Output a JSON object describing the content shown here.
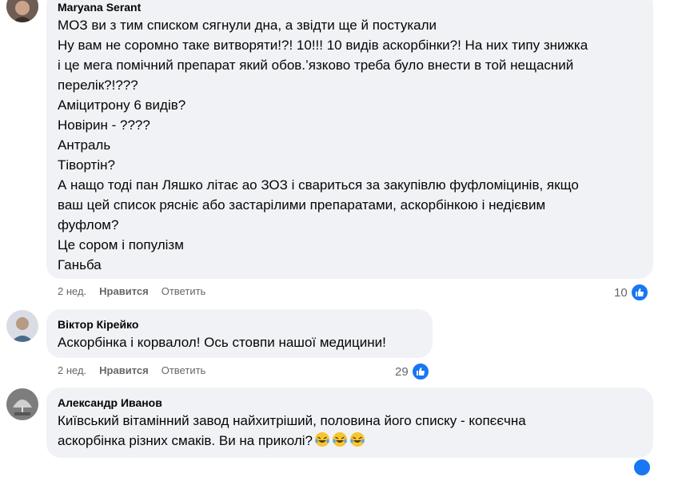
{
  "comments": [
    {
      "author": "Maryana Serant",
      "lines": [
        "МОЗ ви з тим списком сягнули дна, а звідти ще й постукали",
        "Ну вам не соромно таке витворяти!?! 10!!! 10 видів аскорбінки?! На них типу знижка",
        "і це мега помічний препарат який обов.’язково треба було внести в той нещасний",
        "перелік?!???",
        "Аміцитрону 6 видів?",
        "Новірин - ????",
        "Антраль",
        "Тівортін?",
        "А нащо тоді пан Ляшко літає ао ЗОЗ і свариться за закупівлю фуфломіцинів, якщо",
        "ваш цей список рясніє або застарілими препаратами, аскорбінкою і недієвим",
        "фуфлом?",
        "Це сором і популізм",
        "Ганьба"
      ],
      "time": "2 нед.",
      "like_label": "Нравится",
      "reply_label": "Ответить",
      "reactions": "10"
    },
    {
      "author": "Віктор Кірейко",
      "lines": [
        "Аскорбінка і корвалол! Ось стовпи нашої медицини!"
      ],
      "time": "2 нед.",
      "like_label": "Нравится",
      "reply_label": "Ответить",
      "reactions": "29"
    },
    {
      "author": "Александр Иванов",
      "lines": [
        "Київський вітамінний завод найхитріший, половина його списку - копєєчна",
        "аскорбінка різних смаків. Ви на приколі?"
      ],
      "emoji": [
        "laughing-tears-emoji",
        "laughing-tears-emoji",
        "laughing-tears-emoji"
      ]
    }
  ],
  "colors": {
    "bubble": "#f0f2f5",
    "like_blue": "#1877f2",
    "meta": "#65676b"
  }
}
